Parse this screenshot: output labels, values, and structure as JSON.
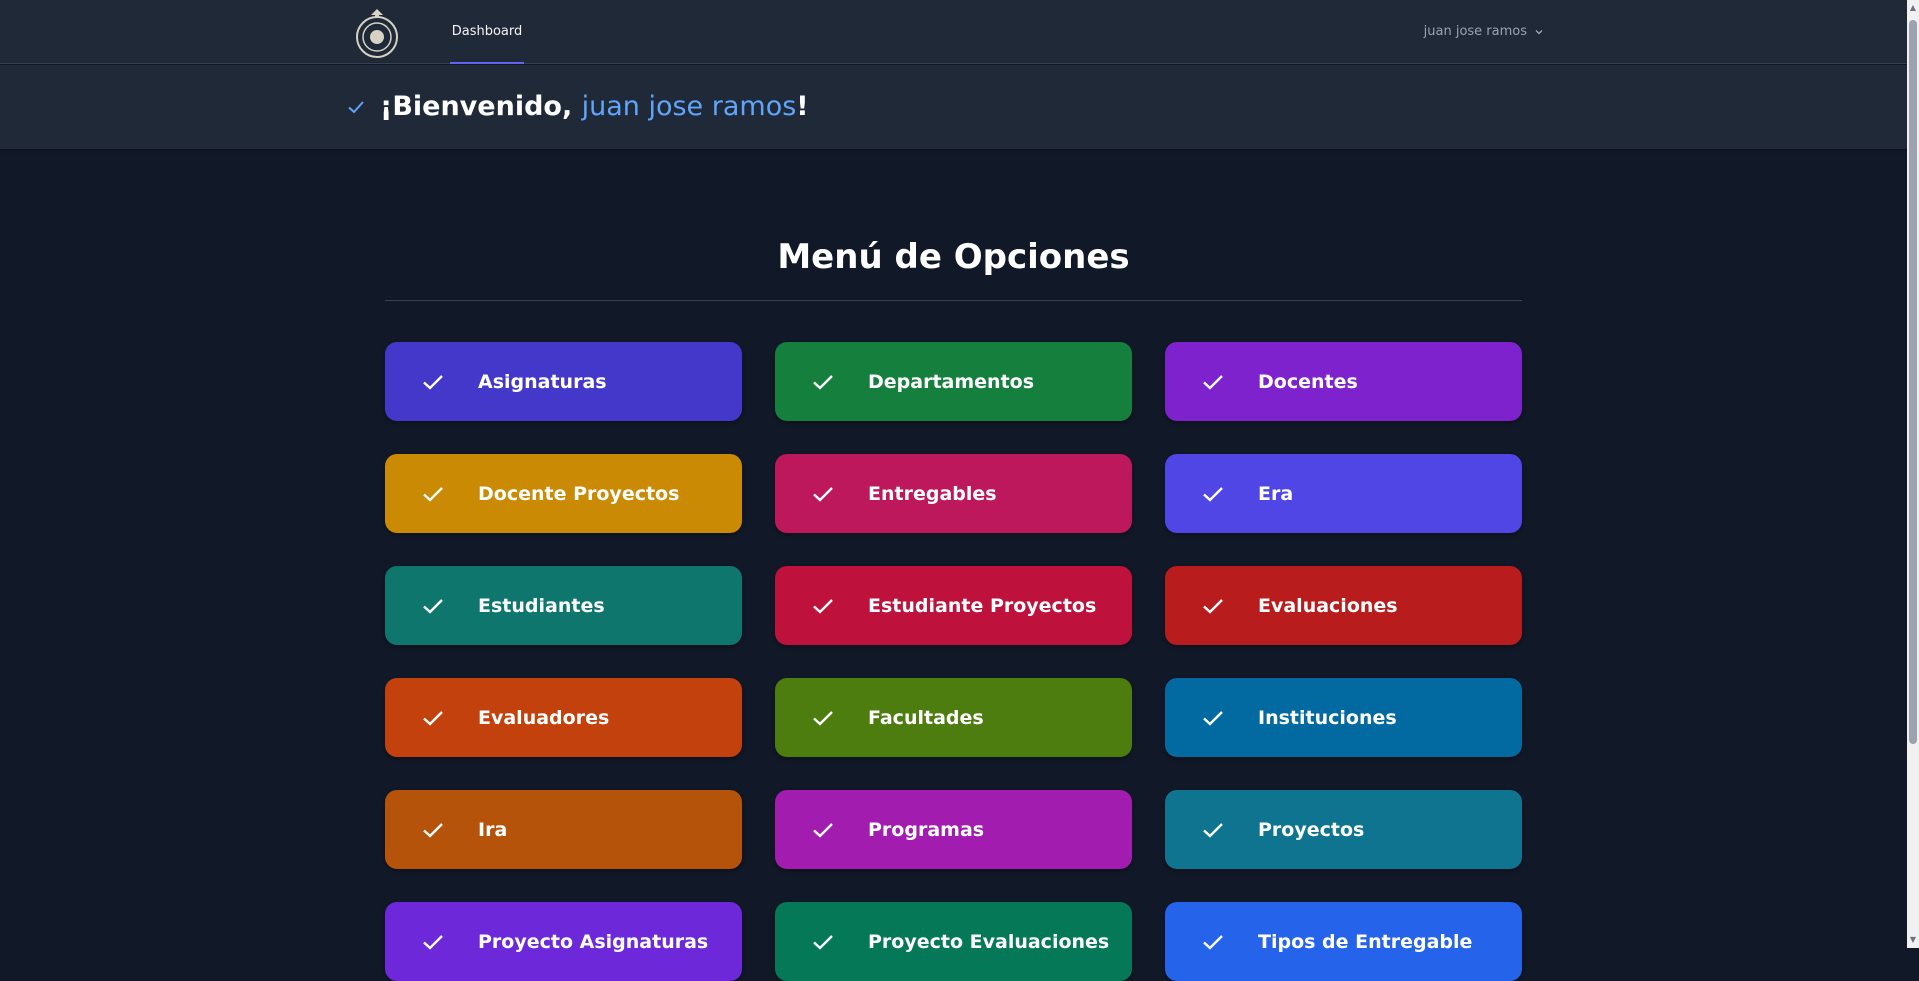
{
  "nav": {
    "dashboard_label": "Dashboard",
    "user_name": "juan jose ramos"
  },
  "welcome": {
    "prefix": "¡Bienvenido, ",
    "name": "juan jose ramos",
    "suffix": "!"
  },
  "menu": {
    "title": "Menú de Opciones",
    "items": [
      {
        "label": "Asignaturas",
        "color": "#4338ca"
      },
      {
        "label": "Departamentos",
        "color": "#15803d"
      },
      {
        "label": "Docentes",
        "color": "#7e22ce"
      },
      {
        "label": "Docente Proyectos",
        "color": "#ca8a04"
      },
      {
        "label": "Entregables",
        "color": "#be185d"
      },
      {
        "label": "Era",
        "color": "#4f46e5"
      },
      {
        "label": "Estudiantes",
        "color": "#0f766e"
      },
      {
        "label": "Estudiante Proyectos",
        "color": "#be123c"
      },
      {
        "label": "Evaluaciones",
        "color": "#b91c1c"
      },
      {
        "label": "Evaluadores",
        "color": "#c2410c"
      },
      {
        "label": "Facultades",
        "color": "#4d7c0f"
      },
      {
        "label": "Instituciones",
        "color": "#0369a1"
      },
      {
        "label": "Ira",
        "color": "#b45309"
      },
      {
        "label": "Programas",
        "color": "#a21caf"
      },
      {
        "label": "Proyectos",
        "color": "#0e7490"
      },
      {
        "label": "Proyecto Asignaturas",
        "color": "#6d28d9"
      },
      {
        "label": "Proyecto Evaluaciones",
        "color": "#047857"
      },
      {
        "label": "Tipos de Entregable",
        "color": "#2563eb"
      }
    ]
  }
}
